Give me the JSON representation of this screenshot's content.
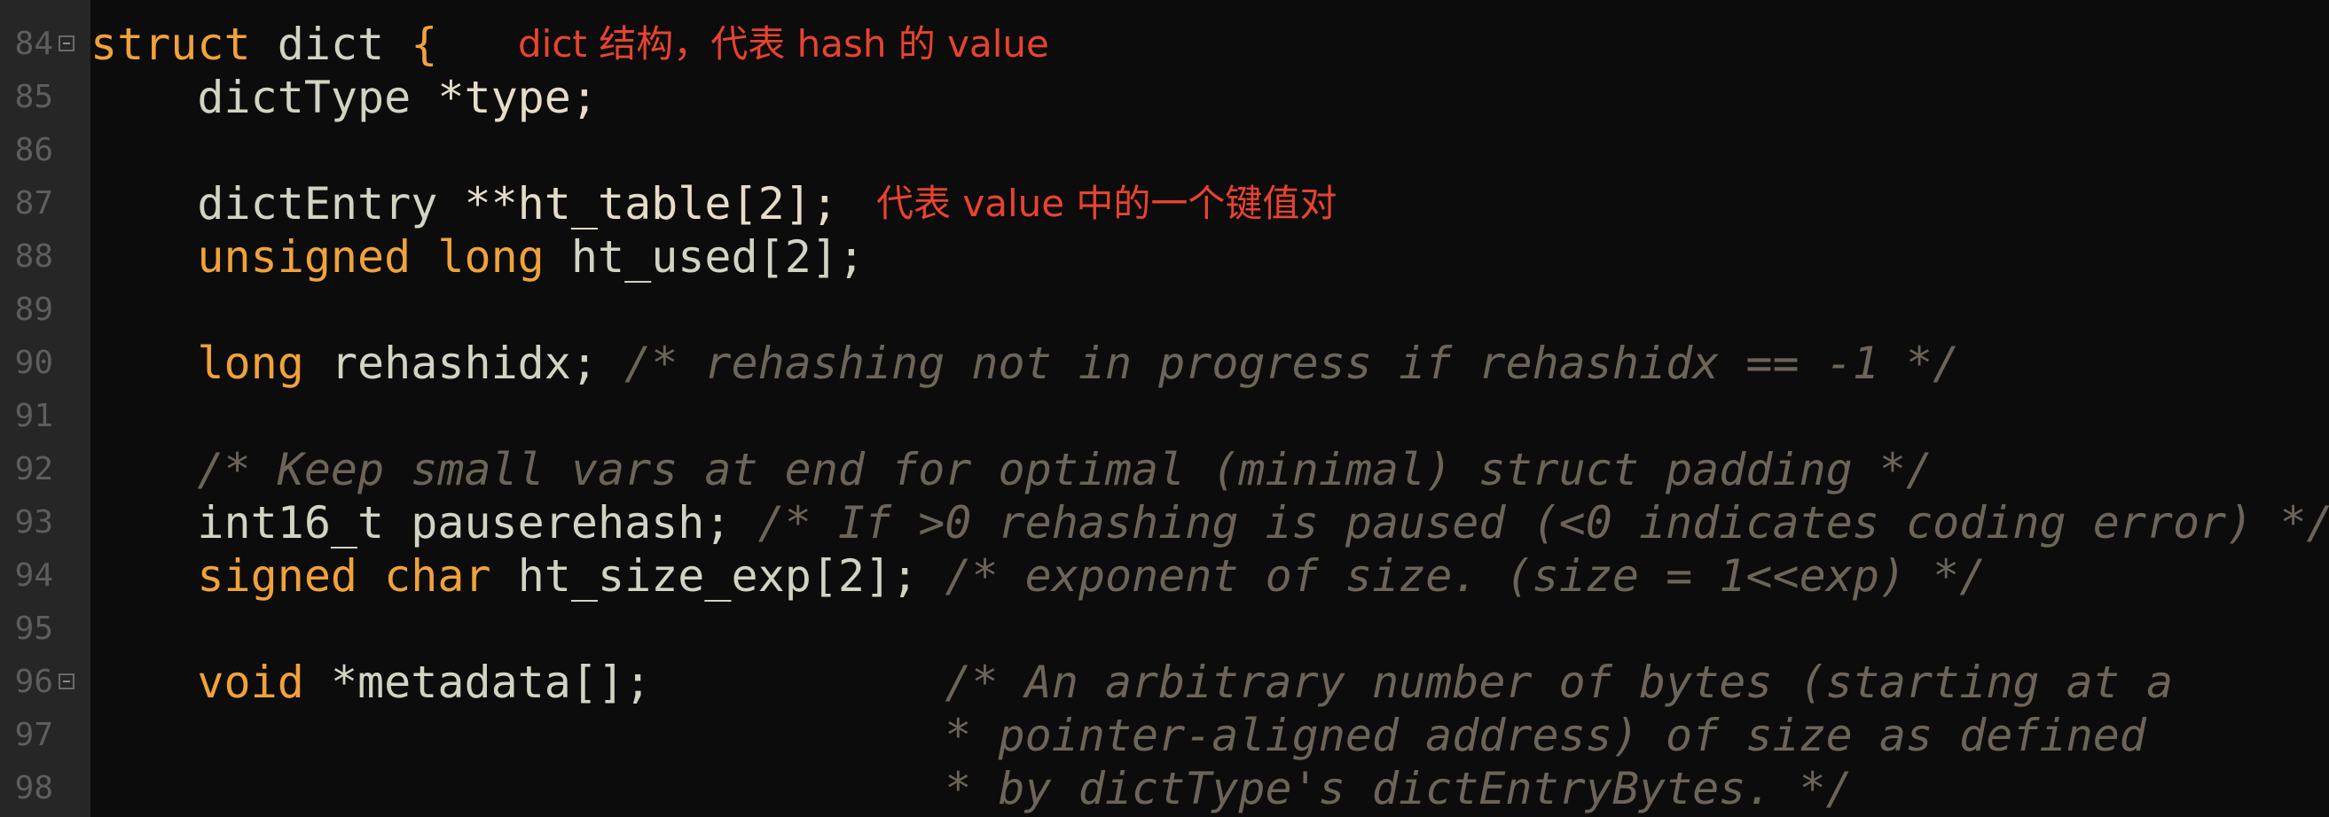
{
  "colors": {
    "background": "#0c0c0c",
    "gutter": "#262626",
    "line_number": "#5e5e5e",
    "keyword": "#f0a23a",
    "identifier": "#d3d3c3",
    "comment": "#6c6458",
    "annotation": "#e8432f"
  },
  "lines": [
    {
      "num": "84",
      "fold": true
    },
    {
      "num": "85"
    },
    {
      "num": "86"
    },
    {
      "num": "87"
    },
    {
      "num": "88"
    },
    {
      "num": "89"
    },
    {
      "num": "90"
    },
    {
      "num": "91"
    },
    {
      "num": "92"
    },
    {
      "num": "93"
    },
    {
      "num": "94"
    },
    {
      "num": "95"
    },
    {
      "num": "96",
      "fold": true
    },
    {
      "num": "97"
    },
    {
      "num": "98"
    }
  ],
  "code": {
    "l84": {
      "kw": "struct",
      "name": "dict",
      "brace": "{"
    },
    "l85": {
      "type": "dictType",
      "rest": "*type;"
    },
    "l87": {
      "type": "dictEntry",
      "rest": "**ht_table[2];"
    },
    "l88": {
      "kw1": "unsigned",
      "kw2": "long",
      "rest": "ht_used[2];"
    },
    "l90": {
      "kw": "long",
      "rest": "rehashidx;",
      "comment": "/* rehashing not in progress if rehashidx == -1 */"
    },
    "l92": {
      "comment": "/* Keep small vars at end for optimal (minimal) struct padding */"
    },
    "l93": {
      "type": "int16_t",
      "rest": "pauserehash;",
      "comment": "/* If >0 rehashing is paused (<0 indicates coding error) */"
    },
    "l94": {
      "kw1": "signed",
      "kw2": "char",
      "rest": "ht_size_exp[2];",
      "comment": "/* exponent of size. (size = 1<<exp) */"
    },
    "l96": {
      "kw": "void",
      "rest": "*metadata[];",
      "comment": "/* An arbitrary number of bytes (starting at a"
    },
    "l97": {
      "comment": "* pointer-aligned address) of size as defined"
    },
    "l98": {
      "comment": "* by dictType's dictEntryBytes. */"
    }
  },
  "annotations": {
    "dict_note": "dict 结构，代表 hash 的 value",
    "entry_note": "代表 value 中的一个键值对"
  }
}
